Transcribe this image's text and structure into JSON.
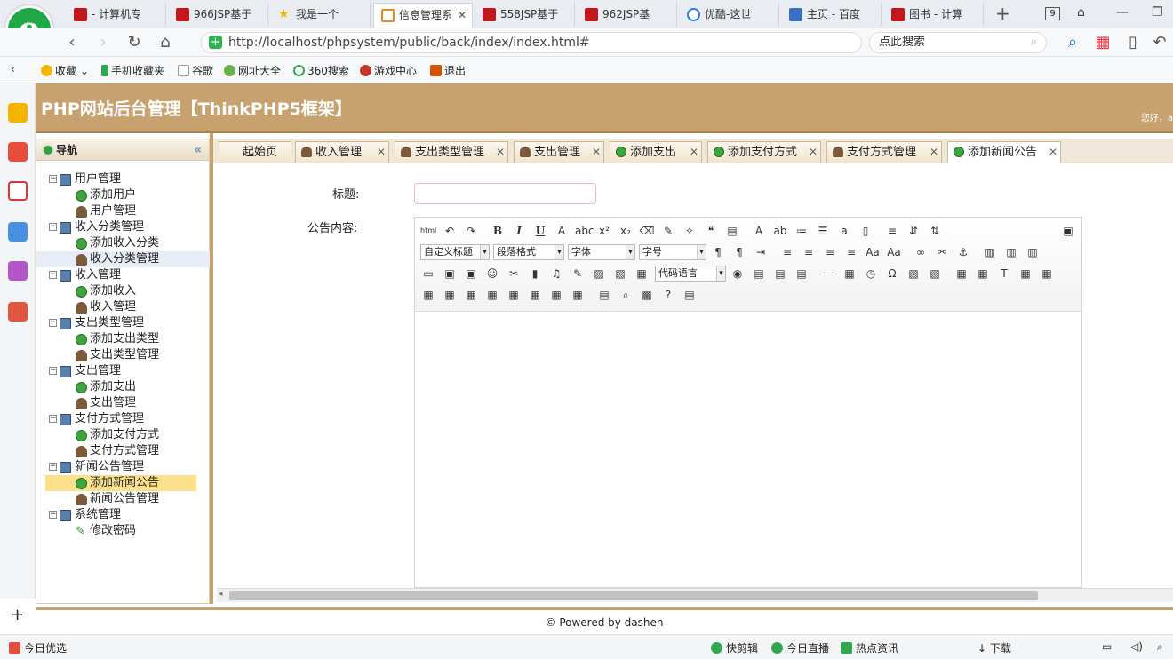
{
  "browser": {
    "tabs": [
      {
        "label": "- 计算机专",
        "icon": "red-app-icon"
      },
      {
        "label": "966JSP基于",
        "icon": "red-app-icon"
      },
      {
        "label": "我是一个",
        "icon": "star-icon"
      },
      {
        "label": "信息管理系",
        "icon": "ie-icon",
        "active": true
      },
      {
        "label": "558JSP基于",
        "icon": "red-app-icon"
      },
      {
        "label": "962JSP基",
        "icon": "red-app-icon"
      },
      {
        "label": "优酷-这世",
        "icon": "youku-icon"
      },
      {
        "label": "主页 - 百度",
        "icon": "home-icon"
      },
      {
        "label": "图书 - 计算",
        "icon": "red-app-icon"
      }
    ],
    "new_tab": "+",
    "tab_count": "9",
    "url": "http://localhost/phpsystem/public/back/index/index.html#",
    "search_placeholder": "点此搜索",
    "bookmarks": [
      "收藏",
      "手机收藏夹",
      "谷歌",
      "网址大全",
      "360搜索",
      "游戏中心",
      "退出"
    ],
    "status_left": "今日优选",
    "status_items": [
      "快剪辑",
      "今日直播",
      "热点资讯",
      "下载"
    ]
  },
  "app": {
    "title": "PHP网站后台管理【ThinkPHP5框架】",
    "greeting": "您好，a",
    "nav_title": "导航",
    "tree": [
      {
        "label": "用户管理",
        "level": 0,
        "icon": "pc"
      },
      {
        "label": "添加用户",
        "level": 1,
        "icon": "add"
      },
      {
        "label": "用户管理",
        "level": 1,
        "icon": "user"
      },
      {
        "label": "收入分类管理",
        "level": 0,
        "icon": "pc"
      },
      {
        "label": "添加收入分类",
        "level": 1,
        "icon": "add"
      },
      {
        "label": "收入分类管理",
        "level": 1,
        "icon": "user"
      },
      {
        "label": "收入管理",
        "level": 0,
        "icon": "pc"
      },
      {
        "label": "添加收入",
        "level": 1,
        "icon": "add"
      },
      {
        "label": "收入管理",
        "level": 1,
        "icon": "user"
      },
      {
        "label": "支出类型管理",
        "level": 0,
        "icon": "pc"
      },
      {
        "label": "添加支出类型",
        "level": 1,
        "icon": "add"
      },
      {
        "label": "支出类型管理",
        "level": 1,
        "icon": "user"
      },
      {
        "label": "支出管理",
        "level": 0,
        "icon": "pc"
      },
      {
        "label": "添加支出",
        "level": 1,
        "icon": "add"
      },
      {
        "label": "支出管理",
        "level": 1,
        "icon": "user"
      },
      {
        "label": "支付方式管理",
        "level": 0,
        "icon": "pc"
      },
      {
        "label": "添加支付方式",
        "level": 1,
        "icon": "add"
      },
      {
        "label": "支付方式管理",
        "level": 1,
        "icon": "user"
      },
      {
        "label": "新闻公告管理",
        "level": 0,
        "icon": "pc"
      },
      {
        "label": "添加新闻公告",
        "level": 1,
        "icon": "add",
        "selected": true
      },
      {
        "label": "新闻公告管理",
        "level": 1,
        "icon": "user"
      },
      {
        "label": "系统管理",
        "level": 0,
        "icon": "pc"
      },
      {
        "label": "修改密码",
        "level": 1,
        "icon": "pen"
      }
    ],
    "tabs": [
      {
        "label": "起始页",
        "icon": "none"
      },
      {
        "label": "收入管理",
        "icon": "user"
      },
      {
        "label": "支出类型管理",
        "icon": "user"
      },
      {
        "label": "支出管理",
        "icon": "user"
      },
      {
        "label": "添加支出",
        "icon": "add"
      },
      {
        "label": "添加支付方式",
        "icon": "add"
      },
      {
        "label": "支付方式管理",
        "icon": "user"
      },
      {
        "label": "添加新闻公告",
        "icon": "add",
        "active": true
      }
    ],
    "form": {
      "title_label": "标题:",
      "title_value": "",
      "content_label": "公告内容:"
    },
    "editor": {
      "selects": [
        "自定义标题",
        "段落格式",
        "字体",
        "字号",
        "代码语言"
      ]
    },
    "footer": "© Powered by dashen"
  }
}
